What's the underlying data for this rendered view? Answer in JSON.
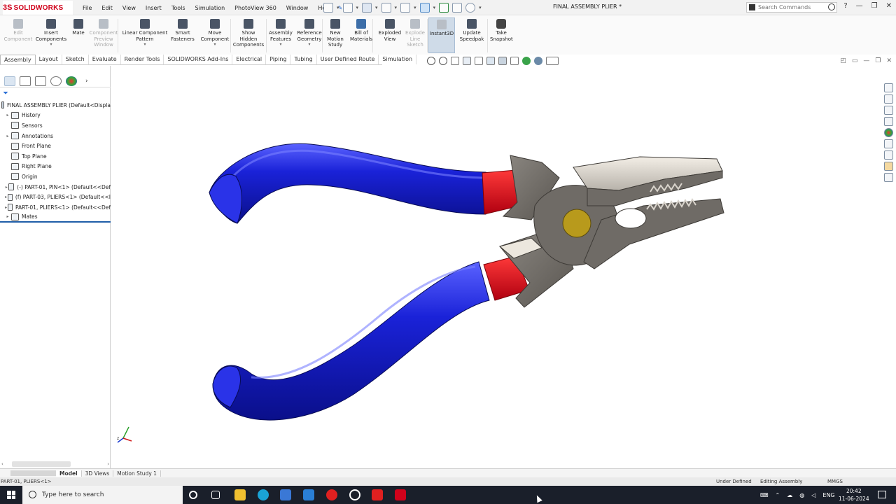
{
  "app": {
    "name": "SOLIDWORKS",
    "logo_mark": "3S",
    "document_title": "FINAL ASSEMBLY PLIER *"
  },
  "menu": [
    "File",
    "Edit",
    "View",
    "Insert",
    "Tools",
    "Simulation",
    "PhotoView 360",
    "Window",
    "Help"
  ],
  "search": {
    "placeholder": "Search Commands"
  },
  "ribbon": [
    {
      "label": "Edit\nComponent",
      "disabled": true
    },
    {
      "label": "Insert\nComponents",
      "disabled": false
    },
    {
      "label": "Mate",
      "disabled": false
    },
    {
      "label": "Component\nPreview\nWindow",
      "disabled": true
    },
    {
      "label": "Linear Component\nPattern",
      "disabled": false
    },
    {
      "label": "Smart\nFasteners",
      "disabled": false
    },
    {
      "label": "Move\nComponent",
      "disabled": false
    },
    {
      "label": "Show\nHidden\nComponents",
      "disabled": false
    },
    {
      "label": "Assembly\nFeatures",
      "disabled": false
    },
    {
      "label": "Reference\nGeometry",
      "disabled": false
    },
    {
      "label": "New\nMotion\nStudy",
      "disabled": false
    },
    {
      "label": "Bill of\nMaterials",
      "disabled": false
    },
    {
      "label": "Exploded\nView",
      "disabled": false
    },
    {
      "label": "Explode\nLine\nSketch",
      "disabled": true
    },
    {
      "label": "Instant3D",
      "disabled": false,
      "active": true
    },
    {
      "label": "Update\nSpeedpak",
      "disabled": false
    },
    {
      "label": "Take\nSnapshot",
      "disabled": false
    }
  ],
  "command_tabs": [
    "Assembly",
    "Layout",
    "Sketch",
    "Evaluate",
    "Render Tools",
    "SOLIDWORKS Add-Ins",
    "Electrical",
    "Piping",
    "Tubing",
    "User Defined Route",
    "Simulation"
  ],
  "feature_tree": [
    {
      "label": "FINAL ASSEMBLY PLIER  (Default<Displa",
      "level": 0,
      "expandable": false,
      "icon": "assembly-icon"
    },
    {
      "label": "History",
      "level": 1,
      "expandable": true,
      "icon": "history-icon"
    },
    {
      "label": "Sensors",
      "level": 1,
      "expandable": false,
      "icon": "sensor-icon"
    },
    {
      "label": "Annotations",
      "level": 1,
      "expandable": true,
      "icon": "annotation-icon"
    },
    {
      "label": "Front Plane",
      "level": 1,
      "expandable": false,
      "icon": "plane-icon"
    },
    {
      "label": "Top Plane",
      "level": 1,
      "expandable": false,
      "icon": "plane-icon"
    },
    {
      "label": "Right Plane",
      "level": 1,
      "expandable": false,
      "icon": "plane-icon"
    },
    {
      "label": "Origin",
      "level": 1,
      "expandable": false,
      "icon": "origin-icon"
    },
    {
      "label": "(-) PART-01, PIN<1> (Default<<Def",
      "level": 1,
      "expandable": true,
      "icon": "part-icon"
    },
    {
      "label": "(f) PART-03, PLIERS<1> (Default<<I",
      "level": 1,
      "expandable": true,
      "icon": "part-icon"
    },
    {
      "label": "PART-01, PLIERS<1> (Default<<Def",
      "level": 1,
      "expandable": true,
      "icon": "part-icon"
    },
    {
      "label": "Mates",
      "level": 1,
      "expandable": true,
      "icon": "mates-icon"
    }
  ],
  "bottom_tabs": [
    "Model",
    "3D Views",
    "Motion Study 1"
  ],
  "status": {
    "selection": "PART-01, PLIERS<1>",
    "define_state": "Under Defined",
    "mode": "Editing Assembly",
    "units": "MMGS"
  },
  "taskbar": {
    "search_placeholder": "Type here to search",
    "language": "ENG",
    "time": "20:42",
    "date": "11-06-2024"
  },
  "colors": {
    "handle": "#1a22d8",
    "grip": "#e0101a",
    "steel": "#6f6b66",
    "pin": "#b89a1c",
    "accent": "#d0021b"
  }
}
